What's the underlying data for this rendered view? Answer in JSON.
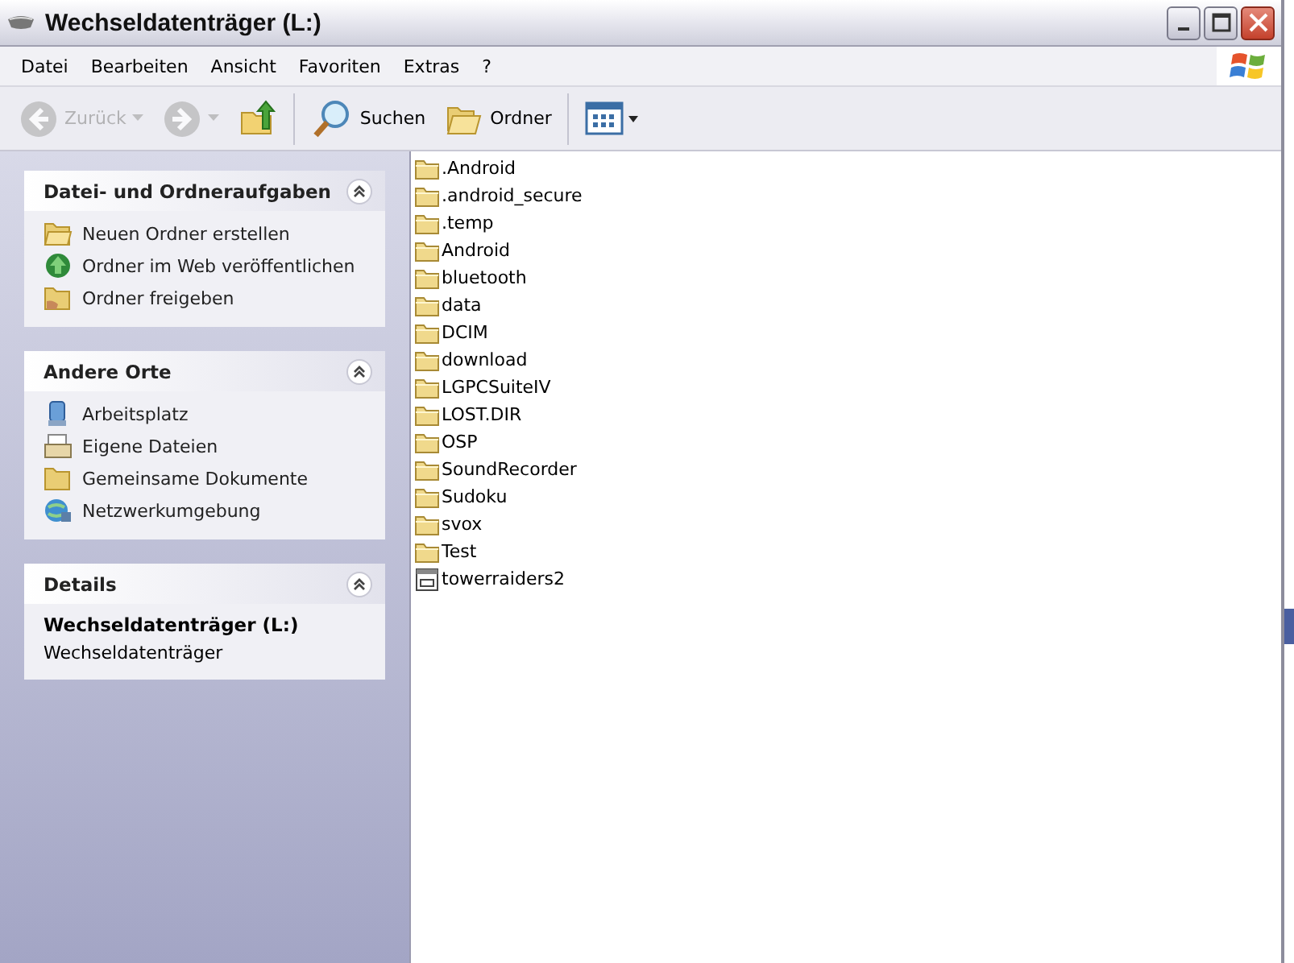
{
  "window": {
    "title": "Wechseldatenträger (L:)"
  },
  "menu": [
    "Datei",
    "Bearbeiten",
    "Ansicht",
    "Favoriten",
    "Extras",
    "?"
  ],
  "toolbar": [
    {
      "kind": "back",
      "label": "Zurück",
      "disabled": true
    },
    {
      "kind": "forward",
      "disabled": true
    },
    {
      "kind": "up",
      "disabled": false
    },
    {
      "kind": "search",
      "label": "Suchen",
      "disabled": false
    },
    {
      "kind": "folders",
      "label": "Ordner",
      "disabled": false
    },
    {
      "kind": "views",
      "disabled": false
    }
  ],
  "sidebar": [
    {
      "title": "Datei- und Ordneraufgaben",
      "kind": "links",
      "expanded": true,
      "items": [
        {
          "kind": "new-folder",
          "label": "Neuen Ordner erstellen"
        },
        {
          "kind": "web",
          "label": "Ordner im Web veröffentlichen"
        },
        {
          "kind": "share",
          "label": "Ordner freigeben"
        }
      ]
    },
    {
      "title": "Andere Orte",
      "kind": "links",
      "expanded": true,
      "items": [
        {
          "kind": "computer",
          "label": "Arbeitsplatz"
        },
        {
          "kind": "documents",
          "label": "Eigene Dateien"
        },
        {
          "kind": "folder",
          "label": "Gemeinsame Dokumente"
        },
        {
          "kind": "network",
          "label": "Netzwerkumgebung"
        }
      ]
    },
    {
      "title": "Details",
      "kind": "details",
      "expanded": true,
      "name": "Wechseldatenträger (L:)",
      "type": "Wechseldatenträger"
    }
  ],
  "files": [
    {
      "name": ".Android",
      "kind": "folder"
    },
    {
      "name": ".android_secure",
      "kind": "folder"
    },
    {
      "name": ".temp",
      "kind": "folder"
    },
    {
      "name": "Android",
      "kind": "folder"
    },
    {
      "name": "bluetooth",
      "kind": "folder"
    },
    {
      "name": "data",
      "kind": "folder"
    },
    {
      "name": "DCIM",
      "kind": "folder"
    },
    {
      "name": "download",
      "kind": "folder"
    },
    {
      "name": "LGPCSuiteIV",
      "kind": "folder"
    },
    {
      "name": "LOST.DIR",
      "kind": "folder"
    },
    {
      "name": "OSP",
      "kind": "folder"
    },
    {
      "name": "SoundRecorder",
      "kind": "folder"
    },
    {
      "name": "Sudoku",
      "kind": "folder"
    },
    {
      "name": "svox",
      "kind": "folder"
    },
    {
      "name": "Test",
      "kind": "folder"
    },
    {
      "name": "towerraiders2",
      "kind": "file"
    }
  ]
}
